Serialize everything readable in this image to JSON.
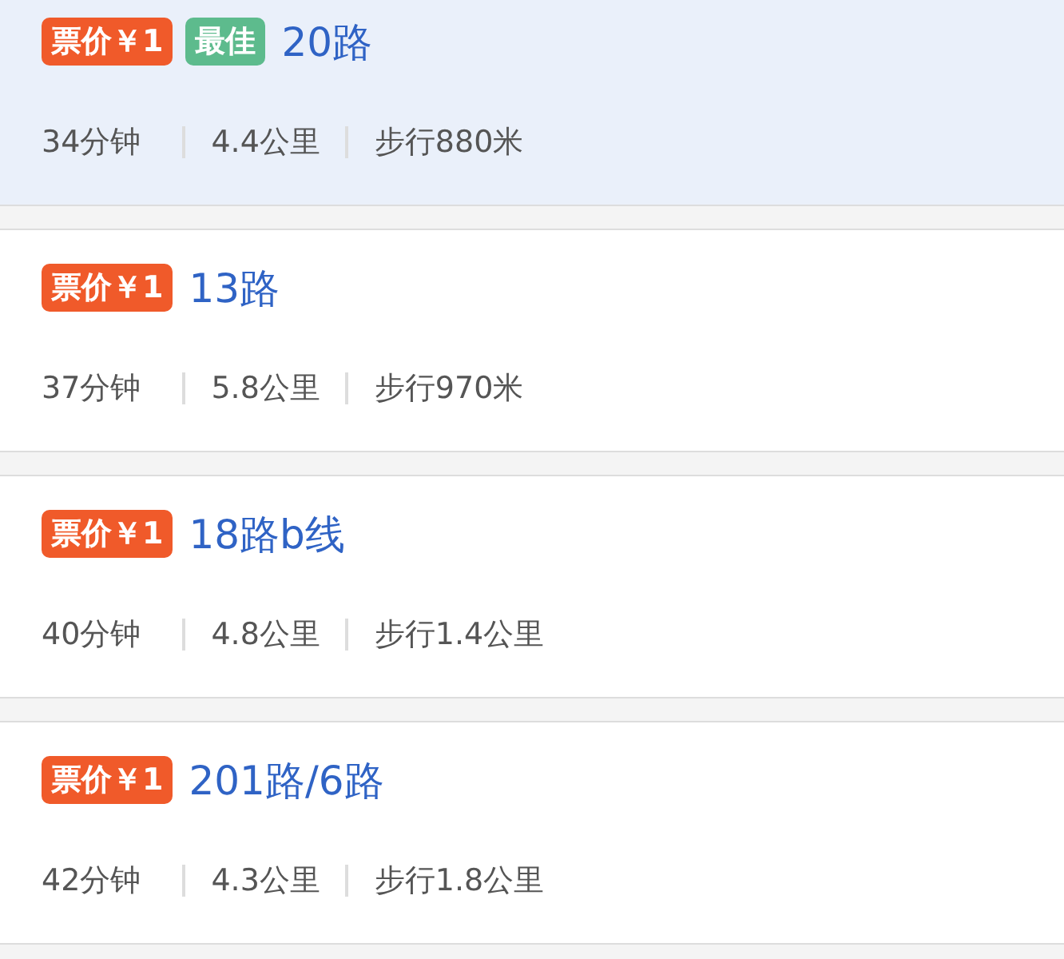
{
  "routes": [
    {
      "selected": true,
      "tags": [
        {
          "kind": "price",
          "text": "票价￥1"
        },
        {
          "kind": "best",
          "text": "最佳"
        }
      ],
      "name": "20路",
      "duration": "34分钟",
      "distance": "4.4公里",
      "walk": "步行880米"
    },
    {
      "selected": false,
      "tags": [
        {
          "kind": "price",
          "text": "票价￥1"
        }
      ],
      "name": "13路",
      "duration": "37分钟",
      "distance": "5.8公里",
      "walk": "步行970米"
    },
    {
      "selected": false,
      "tags": [
        {
          "kind": "price",
          "text": "票价￥1"
        }
      ],
      "name": "18路b线",
      "duration": "40分钟",
      "distance": "4.8公里",
      "walk": "步行1.4公里"
    },
    {
      "selected": false,
      "tags": [
        {
          "kind": "price",
          "text": "票价￥1"
        }
      ],
      "name": "201路/6路",
      "duration": "42分钟",
      "distance": "4.3公里",
      "walk": "步行1.8公里"
    }
  ]
}
